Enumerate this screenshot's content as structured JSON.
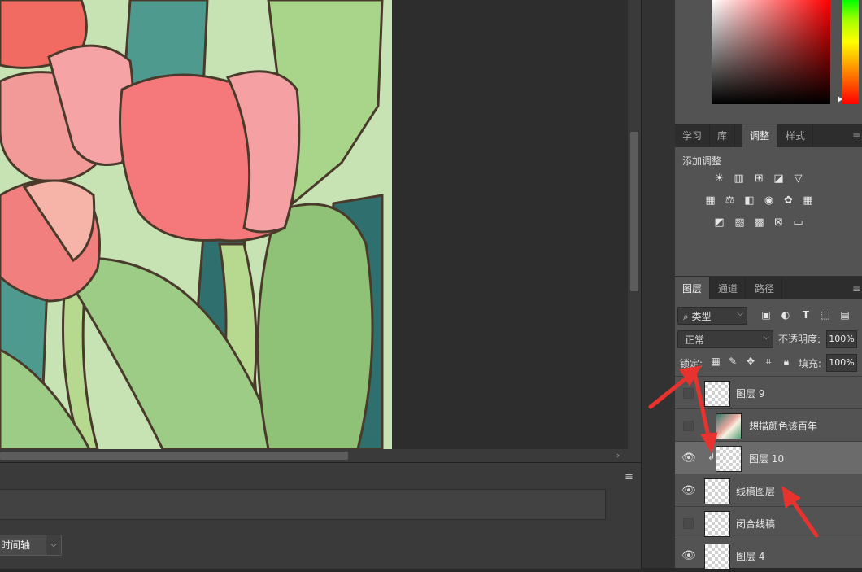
{
  "timeline": {
    "create_label": "时间轴",
    "dropdown_icon": "chevron-down-icon"
  },
  "panels": {
    "color": {
      "hue_top": "#00ff00",
      "selected_hue": "#ff0000"
    },
    "adjust_tabs": [
      {
        "label": "学习"
      },
      {
        "label": "库"
      },
      {
        "label": "调整",
        "active": true
      },
      {
        "label": "样式"
      }
    ],
    "adjustments": {
      "title": "添加调整",
      "rows": [
        [
          "brightness-contrast-icon",
          "levels-icon",
          "curves-icon",
          "exposure-icon",
          "gradient-triangle-icon"
        ],
        [
          "vibrance-icon",
          "balance-icon",
          "black-white-icon",
          "photo-filter-icon",
          "channel-mixer-icon",
          "color-lookup-icon"
        ],
        [
          "invert-icon",
          "posterize-icon",
          "threshold-icon",
          "selective-color-icon",
          "gradient-map-icon"
        ]
      ]
    },
    "layers_tabs": [
      {
        "label": "图层",
        "active": true
      },
      {
        "label": "通道"
      },
      {
        "label": "路径"
      }
    ],
    "layers": {
      "filter_kind": "类型",
      "blend_mode": "正常",
      "opacity_label": "不透明度:",
      "opacity_value": "100%",
      "lock_label": "锁定:",
      "fill_label": "填充:",
      "fill_value": "100%",
      "items": [
        {
          "name": "图层 9",
          "visible": false
        },
        {
          "name": "想描颜色该百年",
          "visible": false,
          "thumb": "photo"
        },
        {
          "name": "图层 10",
          "visible": true,
          "selected": true,
          "clipped": true
        },
        {
          "name": "线稿图层",
          "visible": true
        },
        {
          "name": "闭合线稿",
          "visible": false
        },
        {
          "name": "图层 4",
          "visible": true
        }
      ]
    }
  },
  "annotations": {
    "arrow_color": "#e8322e"
  }
}
